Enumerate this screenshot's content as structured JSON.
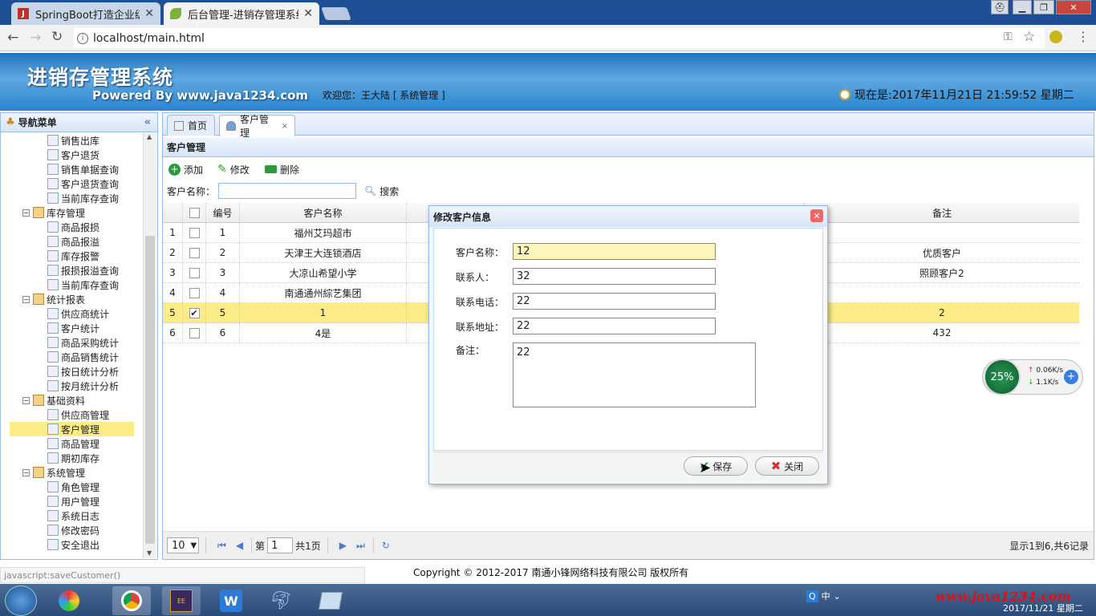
{
  "browser": {
    "tabs": [
      {
        "label": "SpringBoot打造企业级进"
      },
      {
        "label": "后台管理-进销存管理系统"
      }
    ],
    "url": "localhost/main.html",
    "status_text": "javascript:saveCustomer()"
  },
  "header": {
    "brand": "进销存管理系统",
    "powered": "Powered By www.java1234.com",
    "welcome": "欢迎您：王大陆 [ 系统管理 ]",
    "clock": "现在是:2017年11月21日 21:59:52 星期二"
  },
  "nav": {
    "title": "导航菜单",
    "items": [
      {
        "label": "销售出库",
        "group": false
      },
      {
        "label": "客户退货",
        "group": false
      },
      {
        "label": "销售单据查询",
        "group": false
      },
      {
        "label": "客户退货查询",
        "group": false
      },
      {
        "label": "当前库存查询",
        "group": false
      },
      {
        "label": "库存管理",
        "group": true
      },
      {
        "label": "商品报损",
        "group": false
      },
      {
        "label": "商品报溢",
        "group": false
      },
      {
        "label": "库存报警",
        "group": false
      },
      {
        "label": "报损报溢查询",
        "group": false
      },
      {
        "label": "当前库存查询",
        "group": false
      },
      {
        "label": "统计报表",
        "group": true
      },
      {
        "label": "供应商统计",
        "group": false
      },
      {
        "label": "客户统计",
        "group": false
      },
      {
        "label": "商品采购统计",
        "group": false
      },
      {
        "label": "商品销售统计",
        "group": false
      },
      {
        "label": "按日统计分析",
        "group": false
      },
      {
        "label": "按月统计分析",
        "group": false
      },
      {
        "label": "基础资料",
        "group": true
      },
      {
        "label": "供应商管理",
        "group": false
      },
      {
        "label": "客户管理",
        "group": false,
        "selected": true
      },
      {
        "label": "商品管理",
        "group": false
      },
      {
        "label": "期初库存",
        "group": false
      },
      {
        "label": "系统管理",
        "group": true
      },
      {
        "label": "角色管理",
        "group": false
      },
      {
        "label": "用户管理",
        "group": false
      },
      {
        "label": "系统日志",
        "group": false
      },
      {
        "label": "修改密码",
        "group": false
      },
      {
        "label": "安全退出",
        "group": false
      }
    ]
  },
  "tabs": {
    "home": "首页",
    "customer": "客户管理"
  },
  "panel": {
    "title": "客户管理",
    "toolbar": {
      "add": "添加",
      "edit": "修改",
      "delete": "删除"
    },
    "search": {
      "label": "客户名称：",
      "button": "搜索"
    }
  },
  "grid": {
    "headers": {
      "id": "编号",
      "name": "客户名称",
      "remark": "备注"
    },
    "rows": [
      {
        "n": "1",
        "id": "1",
        "name": "福州艾玛超市",
        "remark": "",
        "checked": false
      },
      {
        "n": "2",
        "id": "2",
        "name": "天津王大连锁酒店",
        "remark": "优质客户",
        "checked": false
      },
      {
        "n": "3",
        "id": "3",
        "name": "大凉山希望小学",
        "remark": "照顾客户2",
        "checked": false
      },
      {
        "n": "4",
        "id": "4",
        "name": "南通通州綜艺集团",
        "remark": "",
        "checked": false
      },
      {
        "n": "5",
        "id": "5",
        "name": "1",
        "remark": "2",
        "checked": true
      },
      {
        "n": "6",
        "id": "6",
        "name": "4是",
        "remark": "432",
        "checked": false
      }
    ]
  },
  "pager": {
    "size": "10",
    "page_label": "第",
    "page": "1",
    "total_pages": "共1页",
    "summary": "显示1到6,共6记录"
  },
  "dialog": {
    "title": "修改客户信息",
    "fields": {
      "name_label": "客户名称：",
      "name": "12",
      "contact_label": "联系人：",
      "contact": "32",
      "phone_label": "联系电话：",
      "phone": "22",
      "address_label": "联系地址：",
      "address": "22",
      "remark_label": "备注：",
      "remark": "22"
    },
    "save": "保存",
    "close": "关闭"
  },
  "speed": {
    "percent": "25%",
    "up": "0.06K/s",
    "down": "1.1K/s"
  },
  "copyright": "Copyright © 2012-2017 南通小锋网络科技有限公司 版权所有",
  "taskbar": {
    "date": "2017/11/21 星期二",
    "watermark": "www.java1234.com"
  }
}
